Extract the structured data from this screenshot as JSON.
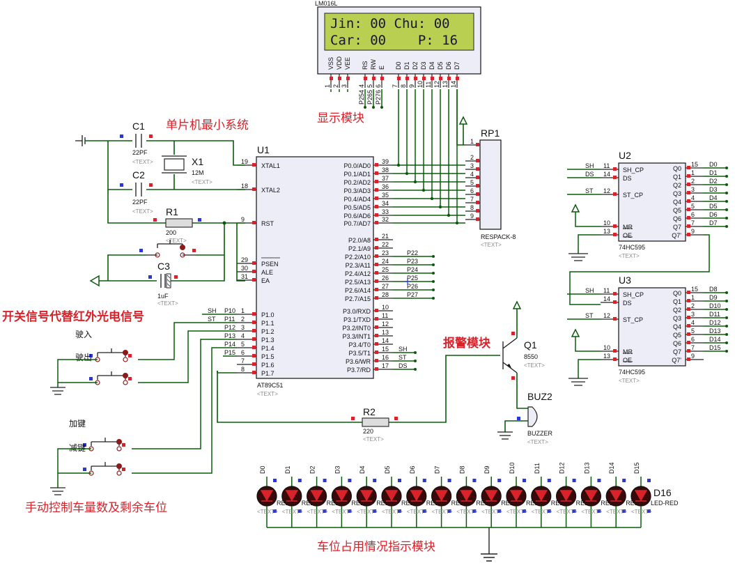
{
  "lcd": {
    "part": "LM016L",
    "line1": "Jin: 00 Chu: 00",
    "line2": "Car: 00    P: 16",
    "pins": [
      "VSS",
      "VDD",
      "VEE",
      "RS",
      "RW",
      "E",
      "D0",
      "D1",
      "D2",
      "D3",
      "D4",
      "D5",
      "D6",
      "D7"
    ],
    "pin_numbers": [
      "1",
      "2",
      "3",
      "4",
      "5",
      "6",
      "7",
      "8",
      "9",
      "10",
      "11",
      "12",
      "13",
      "14"
    ],
    "net_labels": [
      "P254",
      "P265",
      "P276"
    ]
  },
  "mcu": {
    "ref": "U1",
    "part": "AT89C51",
    "text_tag": "<TEXT>",
    "left_pins": [
      {
        "num": "19",
        "name": "XTAL1"
      },
      {
        "num": "18",
        "name": "XTAL2"
      },
      {
        "num": "9",
        "name": "RST"
      },
      {
        "num": "29",
        "name": "PSEN"
      },
      {
        "num": "30",
        "name": "ALE"
      },
      {
        "num": "31",
        "name": "EA"
      },
      {
        "num": "1",
        "name": "P1.0"
      },
      {
        "num": "2",
        "name": "P1.1"
      },
      {
        "num": "3",
        "name": "P1.2"
      },
      {
        "num": "4",
        "name": "P1.3"
      },
      {
        "num": "5",
        "name": "P1.4"
      },
      {
        "num": "6",
        "name": "P1.5"
      },
      {
        "num": "7",
        "name": "P1.6"
      },
      {
        "num": "8",
        "name": "P1.7"
      }
    ],
    "right_pins": [
      {
        "num": "39",
        "name": "P0.0/AD0"
      },
      {
        "num": "38",
        "name": "P0.1/AD1"
      },
      {
        "num": "37",
        "name": "P0.2/AD2"
      },
      {
        "num": "36",
        "name": "P0.3/AD3"
      },
      {
        "num": "35",
        "name": "P0.4/AD4"
      },
      {
        "num": "34",
        "name": "P0.5/AD5"
      },
      {
        "num": "33",
        "name": "P0.6/AD6"
      },
      {
        "num": "32",
        "name": "P0.7/AD7"
      },
      {
        "num": "21",
        "name": "P2.0/A8"
      },
      {
        "num": "22",
        "name": "P2.1/A9"
      },
      {
        "num": "23",
        "name": "P2.2/A10"
      },
      {
        "num": "24",
        "name": "P2.3/A11"
      },
      {
        "num": "25",
        "name": "P2.4/A12"
      },
      {
        "num": "26",
        "name": "P2.5/A13"
      },
      {
        "num": "27",
        "name": "P2.6/A14"
      },
      {
        "num": "28",
        "name": "P2.7/A15"
      },
      {
        "num": "10",
        "name": "P3.0/RXD"
      },
      {
        "num": "11",
        "name": "P3.1/TXD"
      },
      {
        "num": "12",
        "name": "P3.2/INT0"
      },
      {
        "num": "13",
        "name": "P3.3/INT1"
      },
      {
        "num": "14",
        "name": "P3.4/T0"
      },
      {
        "num": "15",
        "name": "P3.5/T1"
      },
      {
        "num": "16",
        "name": "P3.6/WR"
      },
      {
        "num": "17",
        "name": "P3.7/RD"
      }
    ],
    "p1_nets": [
      "SH",
      "ST",
      "P12",
      "P13",
      "P14",
      "P15"
    ],
    "p1_netnums": [
      "P10",
      "P11",
      "P12",
      "P13",
      "P14",
      "P15"
    ],
    "p2_nets": [
      "P22",
      "P23",
      "P24",
      "P25",
      "P26",
      "P27"
    ],
    "p3_nets": [
      "SH",
      "ST",
      "DS"
    ]
  },
  "components": {
    "c1": {
      "ref": "C1",
      "value": "22PF",
      "tag": "<TEXT>"
    },
    "c2": {
      "ref": "C2",
      "value": "22PF",
      "tag": "<TEXT>"
    },
    "c3": {
      "ref": "C3",
      "value": "1uF",
      "tag": "<TEXT>"
    },
    "x1": {
      "ref": "X1",
      "value": "12M",
      "tag": "<TEXT>"
    },
    "r1": {
      "ref": "R1",
      "value": "200",
      "tag": "<TEXT>"
    },
    "r2": {
      "ref": "R2",
      "value": "220",
      "tag": "<TEXT>"
    },
    "rp1": {
      "ref": "RP1",
      "value": "RESPACK-8",
      "tag": "<TEXT>",
      "pins": [
        "1",
        "2",
        "3",
        "4",
        "5",
        "6",
        "7",
        "8",
        "9"
      ]
    },
    "q1": {
      "ref": "Q1",
      "value": "8550",
      "tag": "<TEXT>"
    },
    "buz2": {
      "ref": "BUZ2",
      "value": "BUZZER",
      "tag": "<TEXT>"
    }
  },
  "shift_registers": [
    {
      "ref": "U2",
      "part": "74HC595",
      "tag": "<TEXT>",
      "left": [
        {
          "num": "11",
          "name": "SH_CP",
          "net": "SH"
        },
        {
          "num": "14",
          "name": "DS",
          "net": "DS"
        },
        {
          "num": "12",
          "name": "ST_CP",
          "net": "ST"
        },
        {
          "num": "10",
          "name": "MR",
          "net": ""
        },
        {
          "num": "13",
          "name": "OE",
          "net": ""
        }
      ],
      "right": [
        {
          "num": "15",
          "name": "Q0",
          "net": "D0"
        },
        {
          "num": "1",
          "name": "Q1",
          "net": "D1"
        },
        {
          "num": "2",
          "name": "Q2",
          "net": "D2"
        },
        {
          "num": "3",
          "name": "Q3",
          "net": "D3"
        },
        {
          "num": "4",
          "name": "Q4",
          "net": "D4"
        },
        {
          "num": "5",
          "name": "Q5",
          "net": "D5"
        },
        {
          "num": "6",
          "name": "Q6",
          "net": "D6"
        },
        {
          "num": "7",
          "name": "Q7",
          "net": "D7"
        },
        {
          "num": "9",
          "name": "Q7'",
          "net": ""
        }
      ]
    },
    {
      "ref": "U3",
      "part": "74HC595",
      "tag": "<TEXT>",
      "left": [
        {
          "num": "11",
          "name": "SH_CP",
          "net": "SH"
        },
        {
          "num": "14",
          "name": "DS",
          "net": ""
        },
        {
          "num": "12",
          "name": "ST_CP",
          "net": "ST"
        },
        {
          "num": "10",
          "name": "MR",
          "net": ""
        },
        {
          "num": "13",
          "name": "OE",
          "net": ""
        }
      ],
      "right": [
        {
          "num": "15",
          "name": "Q0",
          "net": "D8"
        },
        {
          "num": "1",
          "name": "Q1",
          "net": "D9"
        },
        {
          "num": "2",
          "name": "Q2",
          "net": "D10"
        },
        {
          "num": "3",
          "name": "Q3",
          "net": "D11"
        },
        {
          "num": "4",
          "name": "Q4",
          "net": "D12"
        },
        {
          "num": "5",
          "name": "Q5",
          "net": "D13"
        },
        {
          "num": "6",
          "name": "Q6",
          "net": "D14"
        },
        {
          "num": "7",
          "name": "Q7",
          "net": "D15"
        },
        {
          "num": "9",
          "name": "Q7'",
          "net": ""
        }
      ]
    }
  ],
  "buttons": [
    {
      "label": "驶入"
    },
    {
      "label": "驶出"
    },
    {
      "label": "加键"
    },
    {
      "label": "减键"
    }
  ],
  "leds": {
    "nets": [
      "D0",
      "D1",
      "D2",
      "D3",
      "D4",
      "D5",
      "D6",
      "D7",
      "D8",
      "D9",
      "D10",
      "D11",
      "D12",
      "D13",
      "D14",
      "D15"
    ],
    "last_ref": "D16",
    "last_part": "LED-RED",
    "part_frag": "RED",
    "tag": "<TEXT>"
  },
  "annotations": {
    "min_system": "单片机最小系统",
    "display_module": "显示模块",
    "switch_signal": "开关信号代替红外光电信号",
    "alarm_module": "报警模块",
    "manual_control": "手动控制车量数及剩余车位",
    "parking_indicator": "车位占用情况指示模块"
  },
  "colors": {
    "wire": "#0b5a0b",
    "pin_red": "#d9222a",
    "pin_blue": "#2a36d6",
    "annotation": "#d9222a",
    "lcd_bg": "#b9cf52",
    "body": "#ecedf7"
  }
}
